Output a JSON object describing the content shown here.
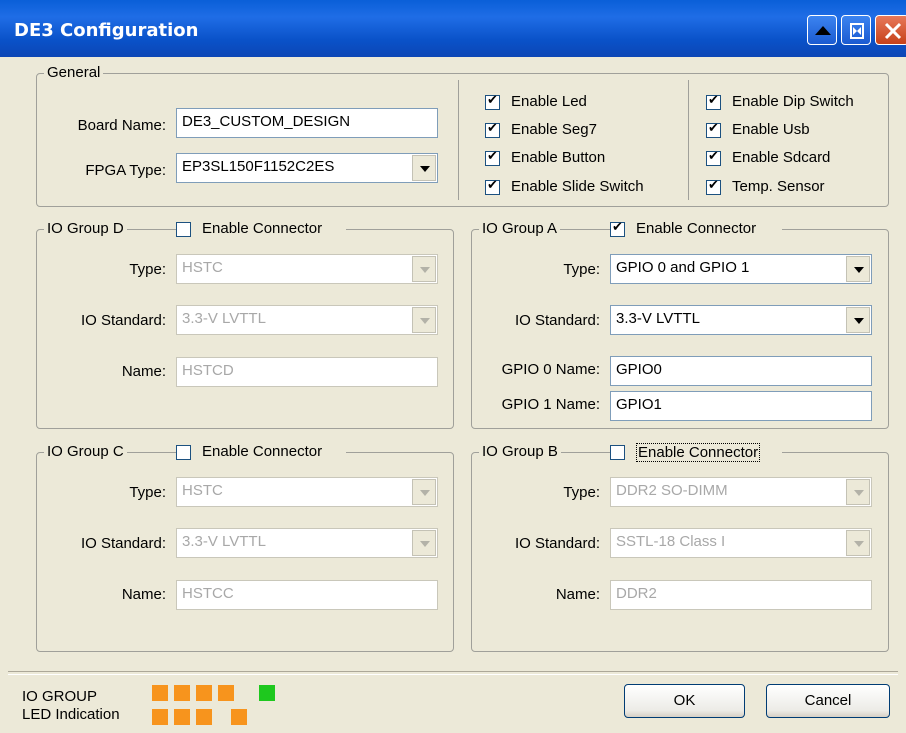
{
  "window": {
    "title": "DE3 Configuration"
  },
  "colors": {
    "led_orange": "#f7941d",
    "led_green": "#1ec81e",
    "title_blue": "#0a52c9"
  },
  "general": {
    "legend": "General",
    "board_name_label": "Board Name:",
    "board_name_value": "DE3_CUSTOM_DESIGN",
    "fpga_type_label": "FPGA Type:",
    "fpga_type_value": "EP3SL150F1152C2ES",
    "options_left": [
      {
        "label": "Enable Led",
        "checked": true
      },
      {
        "label": "Enable Seg7",
        "checked": true
      },
      {
        "label": "Enable Button",
        "checked": true
      },
      {
        "label": "Enable Slide Switch",
        "checked": true
      }
    ],
    "options_right": [
      {
        "label": "Enable Dip Switch",
        "checked": true
      },
      {
        "label": "Enable Usb",
        "checked": true
      },
      {
        "label": "Enable Sdcard",
        "checked": true
      },
      {
        "label": "Temp. Sensor",
        "checked": true
      }
    ]
  },
  "group_d": {
    "legend": "IO Group D",
    "enable_label": "Enable Connector",
    "enabled": false,
    "type_label": "Type:",
    "type_value": "HSTC",
    "standard_label": "IO Standard:",
    "standard_value": "3.3-V LVTTL",
    "name_label": "Name:",
    "name_value": "HSTCD"
  },
  "group_a": {
    "legend": "IO Group A",
    "enable_label": "Enable Connector",
    "enabled": true,
    "type_label": "Type:",
    "type_value": "GPIO 0 and GPIO 1",
    "standard_label": "IO Standard:",
    "standard_value": "3.3-V LVTTL",
    "gpio0_label": "GPIO 0 Name:",
    "gpio0_value": "GPIO0",
    "gpio1_label": "GPIO 1 Name:",
    "gpio1_value": "GPIO1"
  },
  "group_c": {
    "legend": "IO Group C",
    "enable_label": "Enable Connector",
    "enabled": false,
    "type_label": "Type:",
    "type_value": "HSTC",
    "standard_label": "IO Standard:",
    "standard_value": "3.3-V LVTTL",
    "name_label": "Name:",
    "name_value": "HSTCC"
  },
  "group_b": {
    "legend": "IO Group B",
    "enable_label": "Enable Connector",
    "enabled": false,
    "type_label": "Type:",
    "type_value": "DDR2 SO-DIMM",
    "standard_label": "IO Standard:",
    "standard_value": "SSTL-18 Class I",
    "name_label": "Name:",
    "name_value": "DDR2"
  },
  "footer": {
    "led_label_line1": "IO GROUP",
    "led_label_line2": "LED Indication",
    "leds_row1": [
      "orange",
      "orange",
      "orange",
      "orange",
      "green"
    ],
    "leds_row2": [
      "orange",
      "orange",
      "orange",
      "orange"
    ],
    "ok_label": "OK",
    "cancel_label": "Cancel"
  }
}
